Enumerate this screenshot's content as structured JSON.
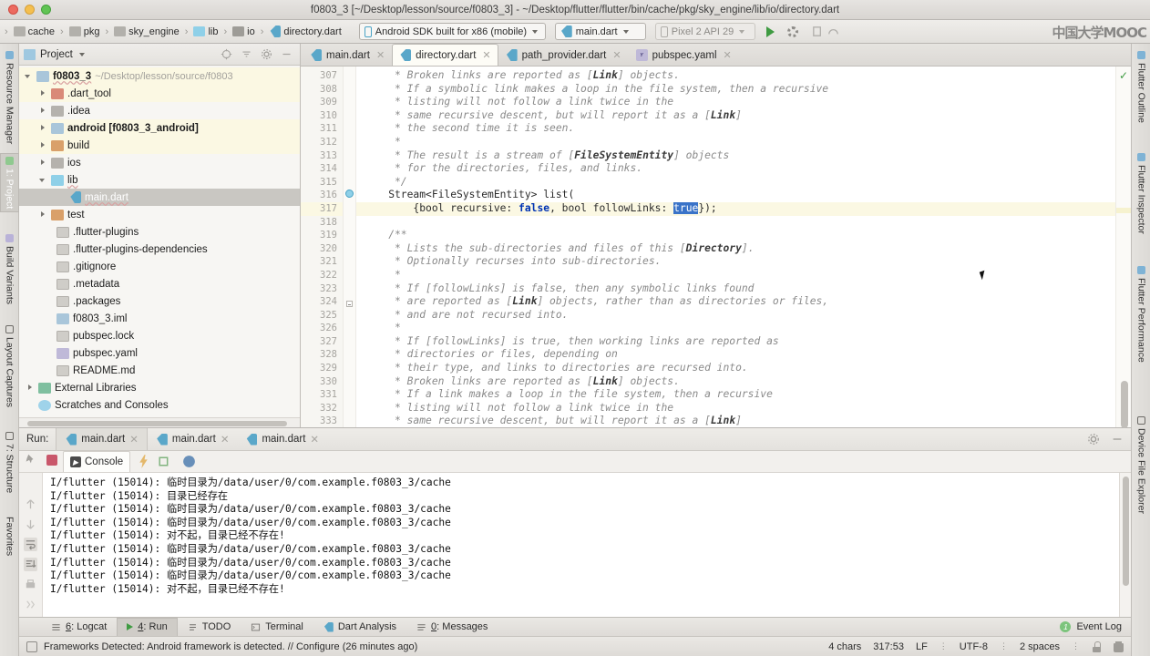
{
  "window": {
    "title": "f0803_3 [~/Desktop/lesson/source/f0803_3] - ~/Desktop/flutter/flutter/bin/cache/pkg/sky_engine/lib/io/directory.dart"
  },
  "toolbar": {
    "breadcrumbs": [
      {
        "label": "cache",
        "icon": "folder-icon"
      },
      {
        "label": "pkg",
        "icon": "folder-icon"
      },
      {
        "label": "sky_engine",
        "icon": "folder-icon"
      },
      {
        "label": "lib",
        "icon": "folder-icon"
      },
      {
        "label": "io",
        "icon": "folder-icon"
      },
      {
        "label": "directory.dart",
        "icon": "dart-file-icon"
      }
    ],
    "device_selector": "Android SDK built for x86 (mobile)",
    "run_config": "main.dart",
    "emulator_target": "Pixel 2 API 29",
    "watermark": "中国大学MOOC"
  },
  "project_panel": {
    "title": "Project",
    "root": {
      "name": "f0803_3",
      "path": "~/Desktop/lesson/source/f0803"
    },
    "items": [
      {
        "label": ".dart_tool",
        "indent": 1,
        "arrow": "closed",
        "icon": "folder-red"
      },
      {
        "label": ".idea",
        "indent": 1,
        "arrow": "closed",
        "icon": "folder"
      },
      {
        "label": "android [f0803_3_android]",
        "indent": 1,
        "arrow": "closed",
        "icon": "folder-mod"
      },
      {
        "label": "build",
        "indent": 1,
        "arrow": "closed",
        "icon": "folder-orange"
      },
      {
        "label": "ios",
        "indent": 1,
        "arrow": "closed",
        "icon": "folder"
      },
      {
        "label": "lib",
        "indent": 1,
        "arrow": "open",
        "icon": "folder-blue"
      },
      {
        "label": "main.dart",
        "indent": 2,
        "arrow": "none",
        "icon": "dart"
      },
      {
        "label": "test",
        "indent": 1,
        "arrow": "closed",
        "icon": "folder-orange"
      },
      {
        "label": ".flutter-plugins",
        "indent": 2,
        "arrow": "none",
        "icon": "file"
      },
      {
        "label": ".flutter-plugins-dependencies",
        "indent": 2,
        "arrow": "none",
        "icon": "file"
      },
      {
        "label": ".gitignore",
        "indent": 2,
        "arrow": "none",
        "icon": "file"
      },
      {
        "label": ".metadata",
        "indent": 2,
        "arrow": "none",
        "icon": "file"
      },
      {
        "label": ".packages",
        "indent": 2,
        "arrow": "none",
        "icon": "file"
      },
      {
        "label": "f0803_3.iml",
        "indent": 2,
        "arrow": "none",
        "icon": "folder-mod"
      },
      {
        "label": "pubspec.lock",
        "indent": 2,
        "arrow": "none",
        "icon": "file"
      },
      {
        "label": "pubspec.yaml",
        "indent": 2,
        "arrow": "none",
        "icon": "yaml"
      },
      {
        "label": "README.md",
        "indent": 2,
        "arrow": "none",
        "icon": "file"
      },
      {
        "label": "External Libraries",
        "indent": 0,
        "arrow": "closed",
        "icon": "lib"
      },
      {
        "label": "Scratches and Consoles",
        "indent": 0,
        "arrow": "none",
        "icon": "scratch"
      }
    ]
  },
  "editor": {
    "tabs": [
      {
        "label": "main.dart",
        "icon": "dart-file-icon",
        "active": false
      },
      {
        "label": "directory.dart",
        "icon": "dart-file-icon",
        "active": true
      },
      {
        "label": "path_provider.dart",
        "icon": "dart-file-icon",
        "active": false
      },
      {
        "label": "pubspec.yaml",
        "icon": "yaml-file-icon",
        "active": false
      }
    ],
    "first_line_number": 307,
    "lines": [
      {
        "n": 307,
        "text": "     * Broken links are reported as [Link] objects.",
        "style": "comment",
        "bold": "Link"
      },
      {
        "n": 308,
        "text": "     * If a symbolic link makes a loop in the file system, then a recursive",
        "style": "comment"
      },
      {
        "n": 309,
        "text": "     * listing will not follow a link twice in the",
        "style": "comment"
      },
      {
        "n": 310,
        "text": "     * same recursive descent, but will report it as a [Link]",
        "style": "comment",
        "bold": "Link"
      },
      {
        "n": 311,
        "text": "     * the second time it is seen.",
        "style": "comment"
      },
      {
        "n": 312,
        "text": "     *",
        "style": "comment"
      },
      {
        "n": 313,
        "text": "     * The result is a stream of [FileSystemEntity] objects",
        "style": "comment",
        "bold": "FileSystemEntity"
      },
      {
        "n": 314,
        "text": "     * for the directories, files, and links.",
        "style": "comment"
      },
      {
        "n": 315,
        "text": "     */",
        "style": "comment"
      },
      {
        "n": 316,
        "text": "    Stream<FileSystemEntity> list(",
        "style": "code"
      },
      {
        "n": 317,
        "text": "        {bool recursive: false, bool followLinks: true});",
        "style": "code-selected"
      },
      {
        "n": 318,
        "text": "",
        "style": "code"
      },
      {
        "n": 319,
        "text": "    /**",
        "style": "comment"
      },
      {
        "n": 320,
        "text": "     * Lists the sub-directories and files of this [Directory].",
        "style": "comment",
        "bold": "Directory"
      },
      {
        "n": 321,
        "text": "     * Optionally recurses into sub-directories.",
        "style": "comment"
      },
      {
        "n": 322,
        "text": "     *",
        "style": "comment"
      },
      {
        "n": 323,
        "text": "     * If [followLinks] is false, then any symbolic links found",
        "style": "comment"
      },
      {
        "n": 324,
        "text": "     * are reported as [Link] objects, rather than as directories or files,",
        "style": "comment",
        "bold": "Link"
      },
      {
        "n": 325,
        "text": "     * and are not recursed into.",
        "style": "comment"
      },
      {
        "n": 326,
        "text": "     *",
        "style": "comment"
      },
      {
        "n": 327,
        "text": "     * If [followLinks] is true, then working links are reported as",
        "style": "comment"
      },
      {
        "n": 328,
        "text": "     * directories or files, depending on",
        "style": "comment"
      },
      {
        "n": 329,
        "text": "     * their type, and links to directories are recursed into.",
        "style": "comment"
      },
      {
        "n": 330,
        "text": "     * Broken links are reported as [Link] objects.",
        "style": "comment",
        "bold": "Link"
      },
      {
        "n": 331,
        "text": "     * If a link makes a loop in the file system, then a recursive",
        "style": "comment"
      },
      {
        "n": 332,
        "text": "     * listing will not follow a link twice in the",
        "style": "comment"
      },
      {
        "n": 333,
        "text": "     * same recursive descent, but will report it as a [Link]",
        "style": "comment",
        "bold": "Link"
      }
    ],
    "selected_text": "true"
  },
  "run_panel": {
    "label": "Run:",
    "tabs": [
      {
        "label": "main.dart",
        "active": true
      },
      {
        "label": "main.dart",
        "active": false
      },
      {
        "label": "main.dart",
        "active": false
      }
    ],
    "console_tab": "Console",
    "output": [
      "I/flutter (15014): 临时目录为/data/user/0/com.example.f0803_3/cache",
      "I/flutter (15014): 目录已经存在",
      "I/flutter (15014): 临时目录为/data/user/0/com.example.f0803_3/cache",
      "I/flutter (15014): 临时目录为/data/user/0/com.example.f0803_3/cache",
      "I/flutter (15014): 对不起，目录已经不存在!",
      "I/flutter (15014): 临时目录为/data/user/0/com.example.f0803_3/cache",
      "I/flutter (15014): 临时目录为/data/user/0/com.example.f0803_3/cache",
      "I/flutter (15014): 临时目录为/data/user/0/com.example.f0803_3/cache",
      "I/flutter (15014): 对不起，目录已经不存在!"
    ]
  },
  "left_tool_tabs": [
    {
      "label": "Resource Manager",
      "selected": false
    },
    {
      "label": "1: Project",
      "selected": true
    },
    {
      "label": "Build Variants",
      "selected": false
    },
    {
      "label": "Layout Captures",
      "selected": false
    },
    {
      "label": "7: Structure",
      "selected": false
    },
    {
      "label": "Favorites",
      "selected": false
    }
  ],
  "right_tool_tabs": [
    {
      "label": "Flutter Outline"
    },
    {
      "label": "Flutter Inspector"
    },
    {
      "label": "Flutter Performance"
    },
    {
      "label": "Device File Explorer"
    }
  ],
  "bottom_tool_strip": {
    "items": [
      {
        "label": "6: Logcat",
        "active": false
      },
      {
        "label": "4: Run",
        "active": true
      },
      {
        "label": "TODO",
        "active": false
      },
      {
        "label": "Terminal",
        "active": false
      },
      {
        "label": "Dart Analysis",
        "active": false
      },
      {
        "label": "0: Messages",
        "active": false
      }
    ],
    "event_log": "Event Log",
    "event_count": "1"
  },
  "status_bar": {
    "message": "Frameworks Detected: Android framework is detected. // Configure (26 minutes ago)",
    "chars": "4 chars",
    "caret": "317:53",
    "line_ending": "LF",
    "encoding": "UTF-8",
    "indent": "2 spaces"
  }
}
